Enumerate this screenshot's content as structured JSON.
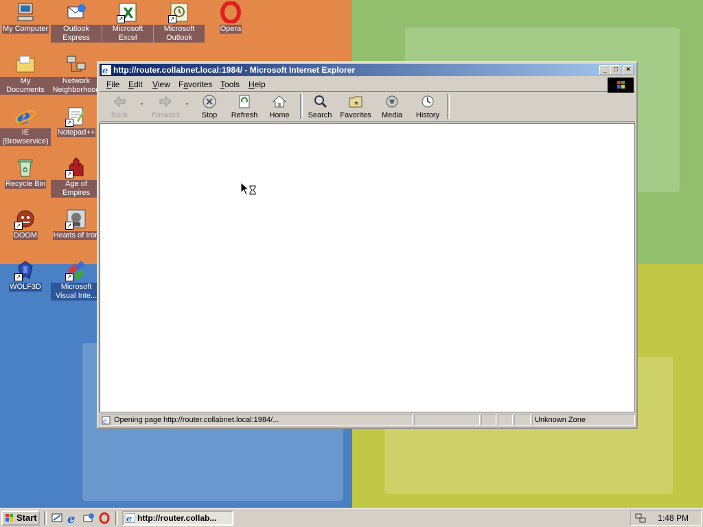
{
  "desktop": {
    "icons": [
      {
        "label": "My Computer",
        "icon": "computer-icon"
      },
      {
        "label": "Outlook Express",
        "icon": "outlook-express-icon"
      },
      {
        "label": "Microsoft Excel",
        "icon": "excel-icon"
      },
      {
        "label": "Microsoft Outlook",
        "icon": "outlook-icon"
      },
      {
        "label": "Opera",
        "icon": "opera-icon"
      },
      {
        "label": "My Documents",
        "icon": "folder-icon"
      },
      {
        "label": "Network Neighborhood",
        "icon": "network-icon"
      },
      {
        "label": "IE (Browservice)",
        "icon": "ie-icon"
      },
      {
        "label": "Notepad++",
        "icon": "notepad-icon"
      },
      {
        "label": "Recycle Bin",
        "icon": "recycle-bin-icon"
      },
      {
        "label": "Age of Empires",
        "icon": "age-of-empires-icon"
      },
      {
        "label": "DOOM",
        "icon": "doom-icon"
      },
      {
        "label": "Hearts of Iron",
        "icon": "hearts-of-iron-icon"
      },
      {
        "label": "WOLF3D",
        "icon": "wolf3d-icon"
      },
      {
        "label": "Microsoft Visual Inte...",
        "icon": "visual-interdev-icon"
      }
    ]
  },
  "window": {
    "title": "http://router.collabnet.local:1984/ - Microsoft Internet Explorer",
    "controls": {
      "minimize": "_",
      "maximize": "□",
      "close": "×"
    },
    "menu": {
      "file": {
        "key": "F",
        "rest": "ile"
      },
      "edit": {
        "key": "E",
        "rest": "dit"
      },
      "view": {
        "key": "V",
        "rest": "iew"
      },
      "favorites": {
        "key": "a",
        "pre": "F",
        "rest": "vorites"
      },
      "tools": {
        "key": "T",
        "rest": "ools"
      },
      "help": {
        "key": "H",
        "rest": "elp"
      }
    },
    "toolbar": {
      "back": "Back",
      "forward": "Forward",
      "stop": "Stop",
      "refresh": "Refresh",
      "home": "Home",
      "search": "Search",
      "favorites": "Favorites",
      "media": "Media",
      "history": "History"
    },
    "status": {
      "text": "Opening page http://router.collabnet.local:1984/...",
      "zone": "Unknown Zone"
    }
  },
  "taskbar": {
    "start": "Start",
    "task_label": "http://router.collab...",
    "clock": "1:48 PM"
  },
  "colors": {
    "title_active_start": "#0a246a",
    "title_active_end": "#a6caf0",
    "face": "#d4d0c8"
  }
}
